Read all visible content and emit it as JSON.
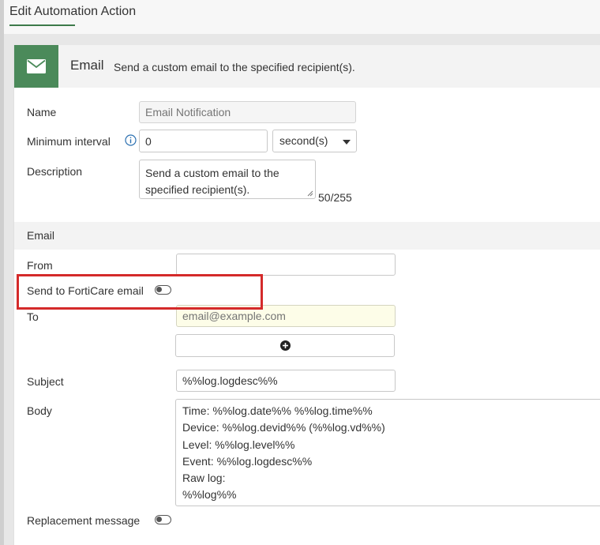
{
  "header": {
    "title": "Edit Automation Action"
  },
  "action": {
    "name": "Email",
    "description": "Send a custom email to the specified recipient(s).",
    "icon": "envelope-icon",
    "icon_color": "#4b8a5a"
  },
  "form": {
    "name_label": "Name",
    "name_placeholder": "Email Notification",
    "min_interval_label": "Minimum interval",
    "min_interval_value": "0",
    "min_interval_unit": "second(s)",
    "description_label": "Description",
    "description_value": "Send a custom email to the specified recipient(s).",
    "description_count": "50/255"
  },
  "email_section": {
    "title": "Email",
    "from_label": "From",
    "from_value": "",
    "forticare_label": "Send to FortiCare email",
    "forticare_enabled": false,
    "to_label": "To",
    "to_placeholder": "email@example.com",
    "subject_label": "Subject",
    "subject_value": "%%log.logdesc%%",
    "body_label": "Body",
    "body_lines": [
      "Time: %%log.date%% %%log.time%%",
      "Device: %%log.devid%% (%%log.vd%%)",
      "Level: %%log.level%%",
      "Event: %%log.logdesc%%",
      "Raw log:",
      "%%log%%"
    ],
    "replacement_label": "Replacement message",
    "replacement_enabled": false
  },
  "colors": {
    "accent_green": "#4b8a5a",
    "highlight_red": "#d42a2a",
    "info_blue": "#2a6fb0"
  }
}
